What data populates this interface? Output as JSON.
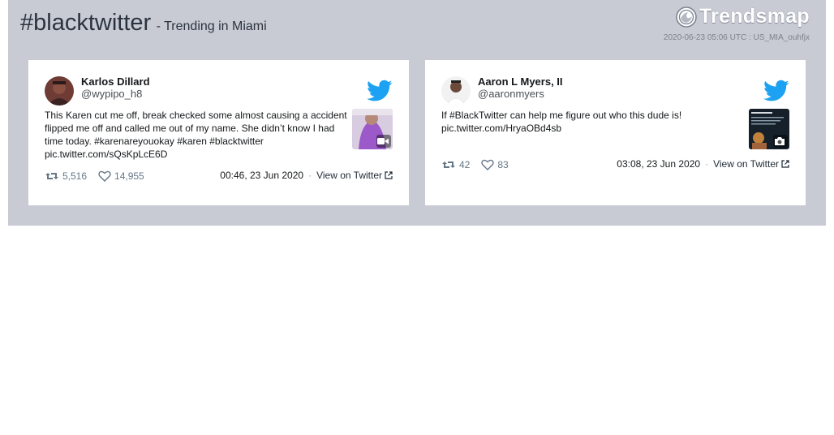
{
  "header": {
    "hashtag": "#blacktwitter",
    "subtitle": "- Trending in Miami",
    "brand": "Trendsmap",
    "meta": "2020-06-23 05:06 UTC : US_MIA_ouhfjx"
  },
  "tweets": [
    {
      "author_name": "Karlos Dillard",
      "author_handle": "@wypipo_h8",
      "text_lines": [
        "This Karen cut me off, break checked some almost causing a accident",
        "flipped me off and called me out of my name. She didn’t know I had",
        "time today. #karenareyouokay #karen #blacktwitter",
        "pic.twitter.com/sQsKpLcE6D"
      ],
      "media_icon": "video-camera-icon",
      "retweets": "5,516",
      "likes": "14,955",
      "time": "00:46, 23 Jun 2020",
      "separator": "·",
      "view_label": "View on Twitter"
    },
    {
      "author_name": "Aaron L Myers, II",
      "author_handle": "@aaronmyers",
      "text_lines": [
        "If #BlackTwitter can help me figure out who this dude is!",
        "pic.twitter.com/HryaOBd4sb"
      ],
      "media_icon": "photo-camera-icon",
      "retweets": "42",
      "likes": "83",
      "time": "03:08, 23 Jun 2020",
      "separator": "·",
      "view_label": "View on Twitter"
    }
  ],
  "colors": {
    "panel_bg": "#c8cbd3",
    "twitter_blue": "#1da1f2",
    "muted": "#657786"
  }
}
